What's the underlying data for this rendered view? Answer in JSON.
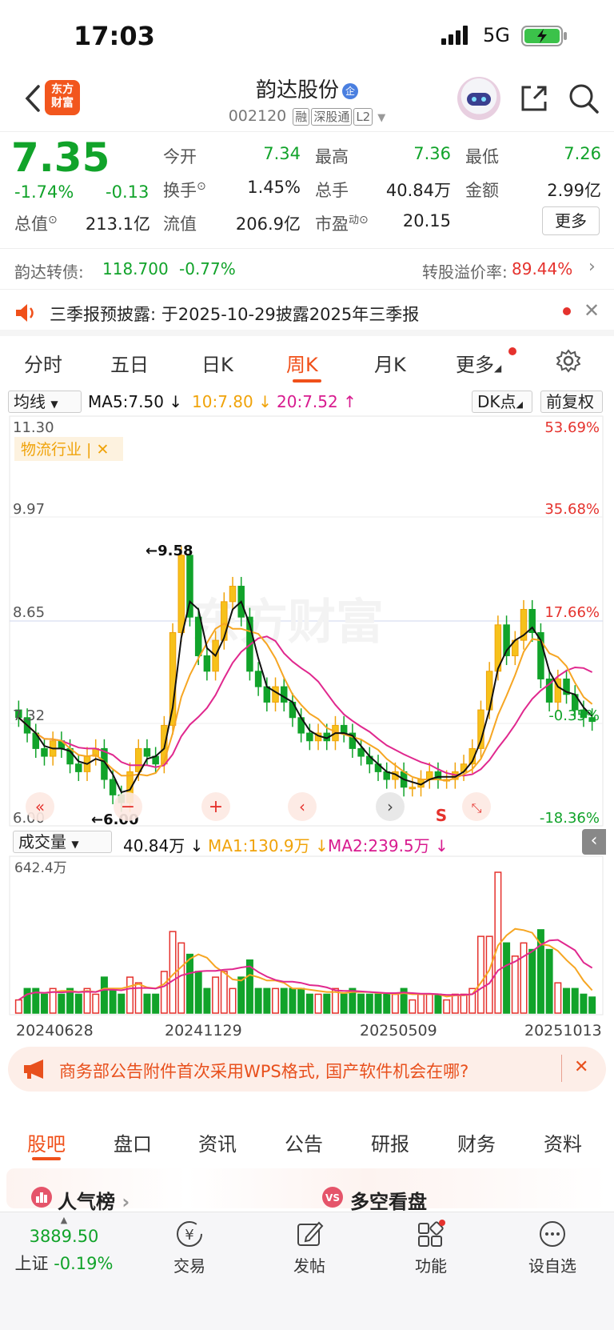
{
  "status": {
    "time": "17:03",
    "network": "5G"
  },
  "header": {
    "logo_line1": "东方",
    "logo_line2": "财富",
    "title": "韵达股份",
    "enterprise_badge": "企",
    "code": "002120",
    "tags": [
      "融",
      "深股通",
      "L2"
    ]
  },
  "quote": {
    "price": "7.35",
    "change_pct": "-1.74%",
    "change_amt": "-0.13",
    "open_label": "今开",
    "open": "7.34",
    "high_label": "最高",
    "high": "7.36",
    "low_label": "最低",
    "low": "7.26",
    "turnover_label": "换手",
    "turnover": "1.45%",
    "volume_label": "总手",
    "volume": "40.84万",
    "amount_label": "金额",
    "amount": "2.99亿",
    "mcap_label": "总值",
    "mcap": "213.1亿",
    "float_label": "流值",
    "float_cap": "206.9亿",
    "pe_label": "市盈",
    "pe_sup": "动",
    "pe": "20.15",
    "more_label": "更多"
  },
  "bond": {
    "name": "韵达转债:",
    "price": "118.700",
    "change": "-0.77%",
    "premium_label": "转股溢价率:",
    "premium": "89.44%"
  },
  "notice": {
    "text": "三季报预披露: 于2025-10-29披露2025年三季报"
  },
  "chart_tabs": [
    "分时",
    "五日",
    "日K",
    "周K",
    "月K",
    "更多"
  ],
  "ma_legend": {
    "selector": "均线",
    "ma5": "MA5:7.50 ↓",
    "ma10": "10:7.80 ↓",
    "ma20": "20:7.52 ↑",
    "dk_label": "DK点",
    "adjust_label": "前复权"
  },
  "kline": {
    "y_labels": [
      "11.30",
      "9.97",
      "8.65",
      "7.32",
      "6.00"
    ],
    "pct_labels": [
      "53.69%",
      "35.68%",
      "17.66%",
      "-0.35%",
      "-18.36%"
    ],
    "industry_tag": "物流行业 | ✕",
    "max_marker": "9.58",
    "min_marker": "6.00",
    "watermark": "东方财富",
    "signal_label": "S"
  },
  "volume": {
    "selector": "成交量",
    "value": "40.84万 ↓",
    "ma1": "MA1:130.9万 ↓",
    "ma2": "MA2:239.5万 ↓",
    "max_label": "642.4万",
    "dates": [
      "20240628",
      "20241129",
      "20250509",
      "20251013"
    ]
  },
  "banner": {
    "text": "商务部公告附件首次采用WPS格式, 国产软件机会在哪?"
  },
  "bottom_tabs": [
    "股吧",
    "盘口",
    "资讯",
    "公告",
    "研报",
    "财务",
    "资料"
  ],
  "popular": {
    "left": "人气榜",
    "right": "多空看盘"
  },
  "footer": {
    "index_value": "3889.50",
    "index_name": "上证",
    "index_change": "-0.19%",
    "items": [
      "交易",
      "发帖",
      "功能",
      "设自选"
    ]
  },
  "colors": {
    "up": "#e5322d",
    "down": "#11a32a",
    "accent": "#f0501a",
    "up_candle_fill": "#f6c11b"
  },
  "chart_data": {
    "type": "candlestick",
    "title": "",
    "ylim": [
      6.0,
      11.3
    ],
    "series_note": "weekly close prices (approx.)",
    "x_dates": [
      "20240628",
      "20241129",
      "20250509",
      "20251013"
    ],
    "close": [
      7.4,
      7.2,
      7.0,
      6.9,
      7.1,
      7.0,
      6.8,
      6.7,
      6.9,
      7.0,
      6.6,
      6.4,
      6.3,
      6.7,
      7.0,
      6.9,
      6.8,
      7.3,
      8.5,
      9.5,
      8.7,
      8.2,
      8.0,
      8.4,
      8.9,
      9.1,
      8.7,
      8.0,
      7.8,
      7.6,
      7.8,
      7.6,
      7.4,
      7.2,
      7.1,
      7.2,
      7.1,
      7.3,
      7.2,
      7.0,
      6.9,
      6.8,
      6.7,
      6.6,
      6.7,
      6.5,
      6.5,
      6.6,
      6.7,
      6.6,
      6.6,
      6.7,
      6.8,
      7.0,
      7.5,
      8.0,
      8.6,
      8.2,
      8.4,
      8.8,
      8.5,
      7.9,
      7.6,
      7.9,
      7.7,
      7.5,
      7.4,
      7.35
    ],
    "volume_unit": "万",
    "volume_max": 642.4
  }
}
